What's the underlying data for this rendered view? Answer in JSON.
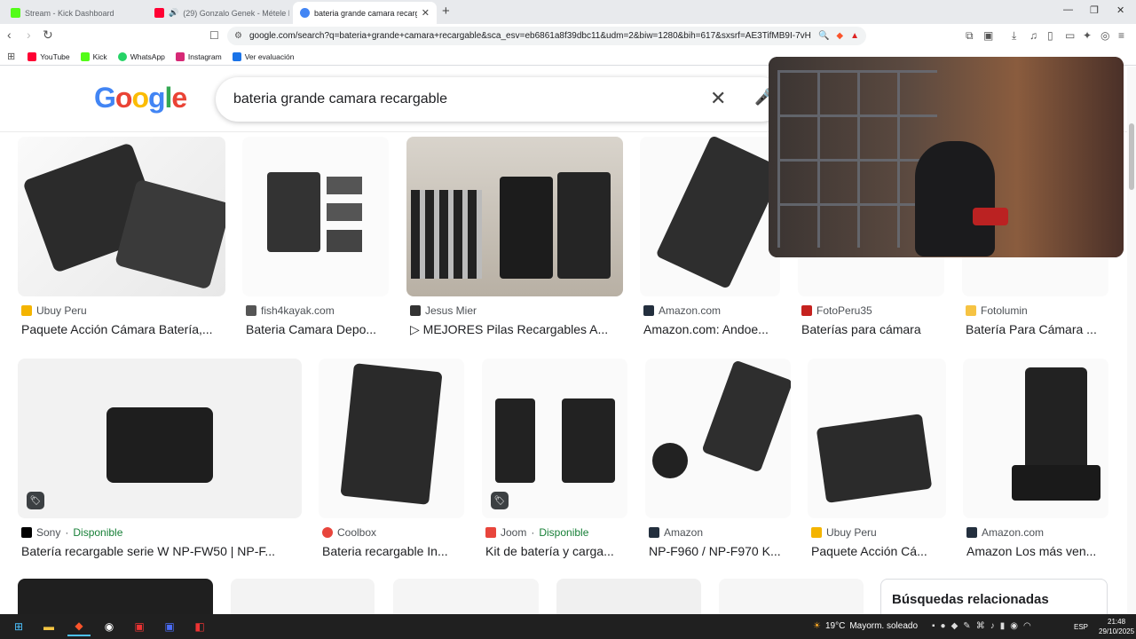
{
  "tabs": [
    {
      "title": "Stream - Kick Dashboard",
      "color": "#53fc18"
    },
    {
      "title": "(29) Gonzalo Genek - Métele Bell",
      "color": "#ff0033"
    },
    {
      "title": "bateria grande camara recargab",
      "color": "#4285f4"
    }
  ],
  "address": {
    "url": "google.com/search?q=bateria+grande+camara+recargable&sca_esv=eb6861a8f39dbc11&udm=2&biw=1280&bih=617&sxsrf=AE3TifMB9I-7vHbUf..."
  },
  "bookmarks": [
    {
      "label": "YouTube",
      "color": "#ff0033"
    },
    {
      "label": "Kick",
      "color": "#53fc18"
    },
    {
      "label": "WhatsApp",
      "color": "#25d366"
    },
    {
      "label": "Instagram",
      "color": "#d62976"
    },
    {
      "label": "Ver evaluación",
      "color": "#1a73e8"
    }
  ],
  "search": {
    "query": "bateria grande camara recargable",
    "logo": "Google"
  },
  "results": [
    {
      "source": "Ubuy Peru",
      "title": "Paquete Acción Cámara Batería,...",
      "favColor": "#f4b400"
    },
    {
      "source": "fish4kayak.com",
      "title": "Bateria Camara Depo...",
      "favColor": "#555555"
    },
    {
      "source": "Jesus Mier",
      "title": "▷ MEJORES Pilas Recargables A...",
      "favColor": "#333333"
    },
    {
      "source": "Amazon.com",
      "title": "Amazon.com: Andoe...",
      "favColor": "#232f3e"
    },
    {
      "source": "FotoPeru35",
      "title": "Baterías para cámara",
      "favColor": "#c5221f"
    },
    {
      "source": "Fotolumin",
      "title": "Batería Para Cámara ...",
      "favColor": "#f6c343"
    },
    {
      "source": "Sony",
      "availability": "Disponible",
      "title": "Batería recargable serie W NP-FW50 | NP-F...",
      "favColor": "#000000"
    },
    {
      "source": "Coolbox",
      "title": "Bateria recargable In...",
      "favColor": "#e8453c"
    },
    {
      "source": "Joom",
      "availability": "Disponible",
      "title": "Kit de batería y carga...",
      "favColor": "#e8453c"
    },
    {
      "source": "Amazon",
      "title": "NP-F960 / NP-F970 K...",
      "favColor": "#232f3e"
    },
    {
      "source": "Ubuy Peru",
      "title": "Paquete Acción Cá...",
      "favColor": "#f4b400"
    },
    {
      "source": "Amazon.com",
      "title": "Amazon Los más ven...",
      "favColor": "#232f3e"
    }
  ],
  "related": {
    "heading": "Búsquedas relacionadas"
  },
  "taskbar": {
    "temp": "19°C",
    "condition": "Mayorm. soleado",
    "lang": "ESP",
    "time": "21:48",
    "date": "29/10/2025"
  },
  "colors": {
    "accent": "#1a73e8",
    "available": "#188038"
  }
}
